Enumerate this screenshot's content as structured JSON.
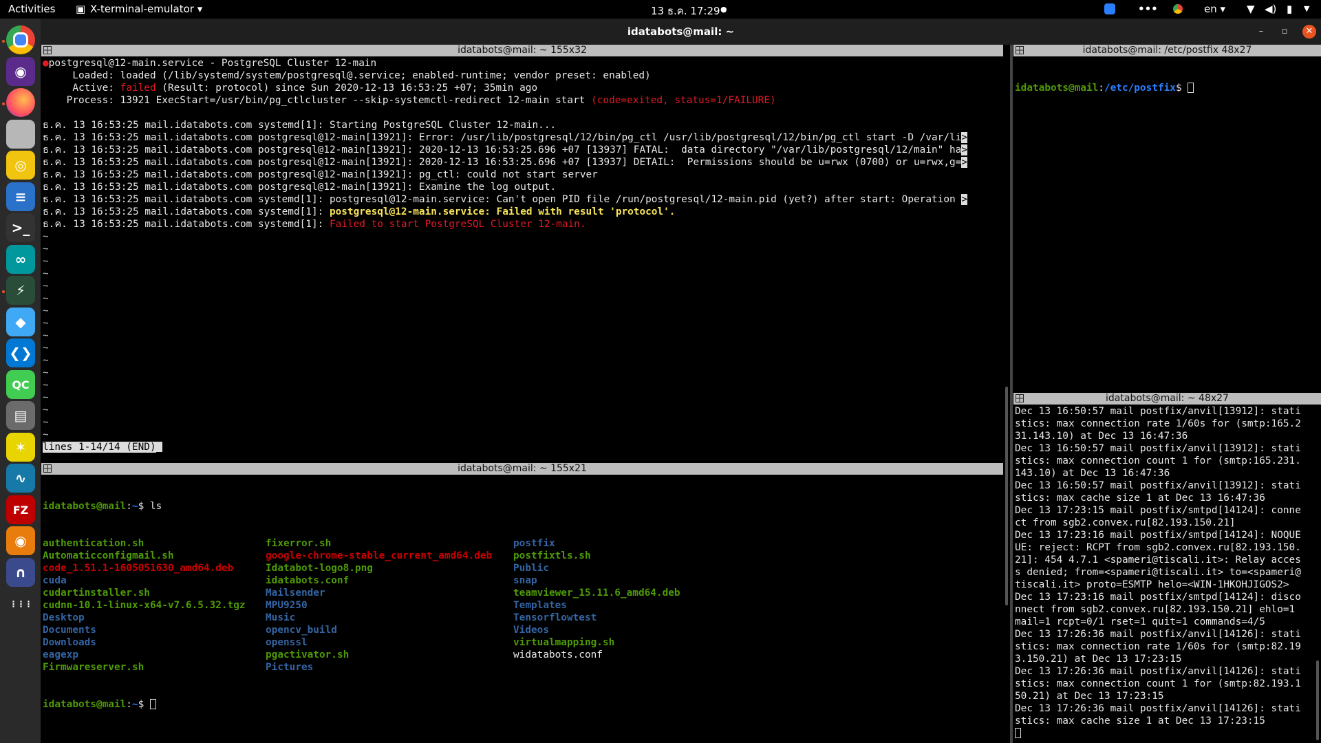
{
  "topbar": {
    "activities": "Activities",
    "app_menu": "X-terminal-emulator ▾",
    "clock": "13 ธ.ค.  17:29",
    "lang": "en ▾"
  },
  "window": {
    "title": "idatabots@mail: ~"
  },
  "dock": [
    {
      "name": "chrome-icon",
      "glyph": "",
      "bg": "#ffffff"
    },
    {
      "name": "podcast-icon",
      "glyph": "◉",
      "bg": "#5b2b8c"
    },
    {
      "name": "firefox-icon",
      "glyph": "",
      "bg": "#ff7139"
    },
    {
      "name": "files-icon",
      "glyph": "",
      "bg": "#b7b7b7"
    },
    {
      "name": "rhythmbox-icon",
      "glyph": "◎",
      "bg": "#f1c40f"
    },
    {
      "name": "writer-icon",
      "glyph": "≡",
      "bg": "#2a71c9"
    },
    {
      "name": "terminal-icon",
      "glyph": ">_",
      "bg": "#333333"
    },
    {
      "name": "arduino-icon",
      "glyph": "∞",
      "bg": "#00979d"
    },
    {
      "name": "bolt-icon",
      "glyph": "⚡",
      "bg": "#2a4d3a"
    },
    {
      "name": "blue-app-icon",
      "glyph": "◆",
      "bg": "#3fa9f5"
    },
    {
      "name": "vscode-icon",
      "glyph": "❮❯",
      "bg": "#0078d4"
    },
    {
      "name": "qc-icon",
      "glyph": "QC",
      "bg": "#41cd52"
    },
    {
      "name": "printer-icon",
      "glyph": "▤",
      "bg": "#6b6b6b"
    },
    {
      "name": "yellow-app-icon",
      "glyph": "✶",
      "bg": "#e8d400"
    },
    {
      "name": "wireshark-icon",
      "glyph": "∿",
      "bg": "#1679a7"
    },
    {
      "name": "filezilla-icon",
      "glyph": "FZ",
      "bg": "#bf0000"
    },
    {
      "name": "blender-icon",
      "glyph": "◉",
      "bg": "#e87d0d"
    },
    {
      "name": "headphones-icon",
      "glyph": "∩",
      "bg": "#3b4a8c"
    },
    {
      "name": "show-apps-icon",
      "glyph": "⋮⋮⋮",
      "bg": "transparent"
    }
  ],
  "pane1": {
    "title": "idatabots@mail: ~ 155x32",
    "lines": [
      {
        "parts": [
          {
            "c": "red",
            "t": "●"
          },
          {
            "c": "white",
            "t": "postgresql@12-main.service - PostgreSQL Cluster 12-main"
          }
        ]
      },
      {
        "parts": [
          {
            "c": "white",
            "t": "     Loaded: loaded (/lib/systemd/system/postgresql@.service; enabled-runtime; vendor preset: enabled)"
          }
        ]
      },
      {
        "parts": [
          {
            "c": "white",
            "t": "     Active: "
          },
          {
            "c": "red",
            "t": "failed"
          },
          {
            "c": "white",
            "t": " (Result: protocol) since Sun 2020-12-13 16:53:25 +07; 35min ago"
          }
        ]
      },
      {
        "parts": [
          {
            "c": "white",
            "t": "    Process: 13921 ExecStart=/usr/bin/pg_ctlcluster --skip-systemctl-redirect 12-main start "
          },
          {
            "c": "red",
            "t": "(code=exited, status=1/FAILURE)"
          }
        ]
      },
      {
        "parts": [
          {
            "c": "white",
            "t": ""
          }
        ]
      },
      {
        "parts": [
          {
            "c": "white",
            "t": "ธ.ค. 13 16:53:25 mail.idatabots.com systemd[1]: Starting PostgreSQL Cluster 12-main..."
          }
        ]
      },
      {
        "parts": [
          {
            "c": "white",
            "t": "ธ.ค. 13 16:53:25 mail.idatabots.com postgresql@12-main[13921]: Error: /usr/lib/postgresql/12/bin/pg_ctl /usr/lib/postgresql/12/bin/pg_ctl start -D /var/li"
          },
          {
            "c": "hl",
            "t": ">"
          }
        ]
      },
      {
        "parts": [
          {
            "c": "white",
            "t": "ธ.ค. 13 16:53:25 mail.idatabots.com postgresql@12-main[13921]: 2020-12-13 16:53:25.696 +07 [13937] FATAL:  data directory \"/var/lib/postgresql/12/main\" ha"
          },
          {
            "c": "hl",
            "t": ">"
          }
        ]
      },
      {
        "parts": [
          {
            "c": "white",
            "t": "ธ.ค. 13 16:53:25 mail.idatabots.com postgresql@12-main[13921]: 2020-12-13 16:53:25.696 +07 [13937] DETAIL:  Permissions should be u=rwx (0700) or u=rwx,g="
          },
          {
            "c": "hl",
            "t": ">"
          }
        ]
      },
      {
        "parts": [
          {
            "c": "white",
            "t": "ธ.ค. 13 16:53:25 mail.idatabots.com postgresql@12-main[13921]: pg_ctl: could not start server"
          }
        ]
      },
      {
        "parts": [
          {
            "c": "white",
            "t": "ธ.ค. 13 16:53:25 mail.idatabots.com postgresql@12-main[13921]: Examine the log output."
          }
        ]
      },
      {
        "parts": [
          {
            "c": "white",
            "t": "ธ.ค. 13 16:53:25 mail.idatabots.com systemd[1]: postgresql@12-main.service: Can't open PID file /run/postgresql/12-main.pid (yet?) after start: Operation "
          },
          {
            "c": "hl",
            "t": ">"
          }
        ]
      },
      {
        "parts": [
          {
            "c": "white",
            "t": "ธ.ค. 13 16:53:25 mail.idatabots.com systemd[1]: "
          },
          {
            "c": "yellow",
            "t": "postgresql@12-main.service: Failed with result 'protocol'."
          }
        ]
      },
      {
        "parts": [
          {
            "c": "white",
            "t": "ธ.ค. 13 16:53:25 mail.idatabots.com systemd[1]: "
          },
          {
            "c": "red",
            "t": "Failed to start PostgreSQL Cluster 12-main."
          }
        ]
      }
    ],
    "tilde": "~",
    "tilde_count": 17,
    "status": "lines 1-14/14 (END)"
  },
  "pane2": {
    "title": "idatabots@mail: ~ 155x21",
    "prompt_user": "idatabots@mail",
    "prompt_path": "~",
    "command": "ls",
    "col1": [
      {
        "t": "authentication.sh",
        "k": "exe"
      },
      {
        "t": "Automaticconfigmail.sh",
        "k": "exe"
      },
      {
        "t": "code_1.51.1-1605051630_amd64.deb",
        "k": "deb"
      },
      {
        "t": "cuda",
        "k": "dir"
      },
      {
        "t": "cudartinstaller.sh",
        "k": "exe"
      },
      {
        "t": "cudnn-10.1-linux-x64-v7.6.5.32.tgz",
        "k": "exe"
      },
      {
        "t": "Desktop",
        "k": "dir"
      },
      {
        "t": "Documents",
        "k": "dir"
      },
      {
        "t": "Downloads",
        "k": "dir"
      },
      {
        "t": "eagexp",
        "k": "dir"
      },
      {
        "t": "Firmwareserver.sh",
        "k": "exe"
      }
    ],
    "col2": [
      {
        "t": "fixerror.sh",
        "k": "exe"
      },
      {
        "t": "google-chrome-stable_current_amd64.deb",
        "k": "deb"
      },
      {
        "t": "Idatabot-logo8.png",
        "k": "exe"
      },
      {
        "t": "idatabots.conf",
        "k": "exe"
      },
      {
        "t": "Mailsender",
        "k": "dir"
      },
      {
        "t": "MPU9250",
        "k": "dir"
      },
      {
        "t": "Music",
        "k": "dir"
      },
      {
        "t": "opencv_build",
        "k": "dir"
      },
      {
        "t": "openssl",
        "k": "dir"
      },
      {
        "t": "pgactivator.sh",
        "k": "exe"
      },
      {
        "t": "Pictures",
        "k": "dir"
      }
    ],
    "col3": [
      {
        "t": "postfix",
        "k": "dir"
      },
      {
        "t": "postfixtls.sh",
        "k": "exe"
      },
      {
        "t": "Public",
        "k": "dir"
      },
      {
        "t": "snap",
        "k": "dir"
      },
      {
        "t": "teamviewer_15.11.6_amd64.deb",
        "k": "exe"
      },
      {
        "t": "Templates",
        "k": "dir"
      },
      {
        "t": "Tensorflowtest",
        "k": "dir"
      },
      {
        "t": "Videos",
        "k": "dir"
      },
      {
        "t": "virtualmapping.sh",
        "k": "exe"
      },
      {
        "t": "widatabots.conf",
        "k": "plain"
      }
    ]
  },
  "pane3": {
    "title": "idatabots@mail: /etc/postfix 48x27",
    "prompt_user": "idatabots@mail",
    "prompt_path": "/etc/postfix"
  },
  "pane4": {
    "title": "idatabots@mail: ~ 48x27",
    "lines": [
      "Dec 13 16:50:57 mail postfix/anvil[13912]: stati",
      "stics: max connection rate 1/60s for (smtp:165.2",
      "31.143.10) at Dec 13 16:47:36",
      "Dec 13 16:50:57 mail postfix/anvil[13912]: stati",
      "stics: max connection count 1 for (smtp:165.231.",
      "143.10) at Dec 13 16:47:36",
      "Dec 13 16:50:57 mail postfix/anvil[13912]: stati",
      "stics: max cache size 1 at Dec 13 16:47:36",
      "Dec 13 17:23:15 mail postfix/smtpd[14124]: conne",
      "ct from sgb2.convex.ru[82.193.150.21]",
      "Dec 13 17:23:16 mail postfix/smtpd[14124]: NOQUE",
      "UE: reject: RCPT from sgb2.convex.ru[82.193.150.",
      "21]: 454 4.7.1 <spameri@tiscali.it>: Relay acces",
      "s denied; from=<spameri@tiscali.it> to=<spameri@",
      "tiscali.it> proto=ESMTP helo=<WIN-1HKOHJIGOS2>",
      "Dec 13 17:23:16 mail postfix/smtpd[14124]: disco",
      "nnect from sgb2.convex.ru[82.193.150.21] ehlo=1",
      "mail=1 rcpt=0/1 rset=1 quit=1 commands=4/5",
      "Dec 13 17:26:36 mail postfix/anvil[14126]: stati",
      "stics: max connection rate 1/60s for (smtp:82.19",
      "3.150.21) at Dec 13 17:23:15",
      "Dec 13 17:26:36 mail postfix/anvil[14126]: stati",
      "stics: max connection count 1 for (smtp:82.193.1",
      "50.21) at Dec 13 17:23:15",
      "Dec 13 17:26:36 mail postfix/anvil[14126]: stati",
      "stics: max cache size 1 at Dec 13 17:23:15"
    ]
  }
}
